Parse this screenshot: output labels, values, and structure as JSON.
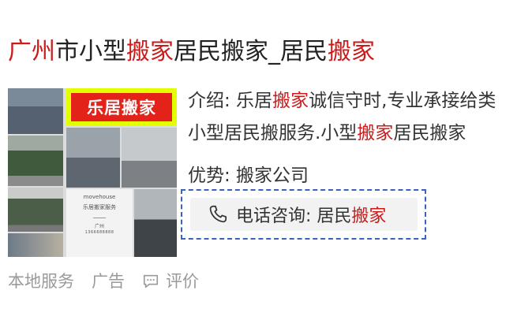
{
  "title": {
    "city": "广州",
    "part1": "市小型",
    "kw1": "搬家",
    "part2": "居民搬家_居民",
    "kw2": "搬家"
  },
  "thumbnail": {
    "banner_text": "乐居搬家",
    "card_brand": "movehouse",
    "card_sub": "乐居搬家服务",
    "card_city": "广州",
    "card_phone": "1366688888"
  },
  "intro": {
    "line1_a": "介绍: 乐居",
    "line1_kw": "搬家",
    "line1_b": "诚信守时,专业承接给类",
    "line2_a": "小型居民搬服务.小型",
    "line2_kw": "搬家",
    "line2_b": "居民搬家"
  },
  "advantage": "优势: 搬家公司",
  "phone": {
    "label": "电话咨询: 居民",
    "kw": "搬家"
  },
  "footer": {
    "local_service": "本地服务",
    "ad": "广告",
    "review": "评价"
  },
  "colors": {
    "highlight": "#c91c1c",
    "dashed_border": "#3a61c4",
    "banner_red": "#e32219",
    "banner_yellow": "#e4ff00"
  }
}
